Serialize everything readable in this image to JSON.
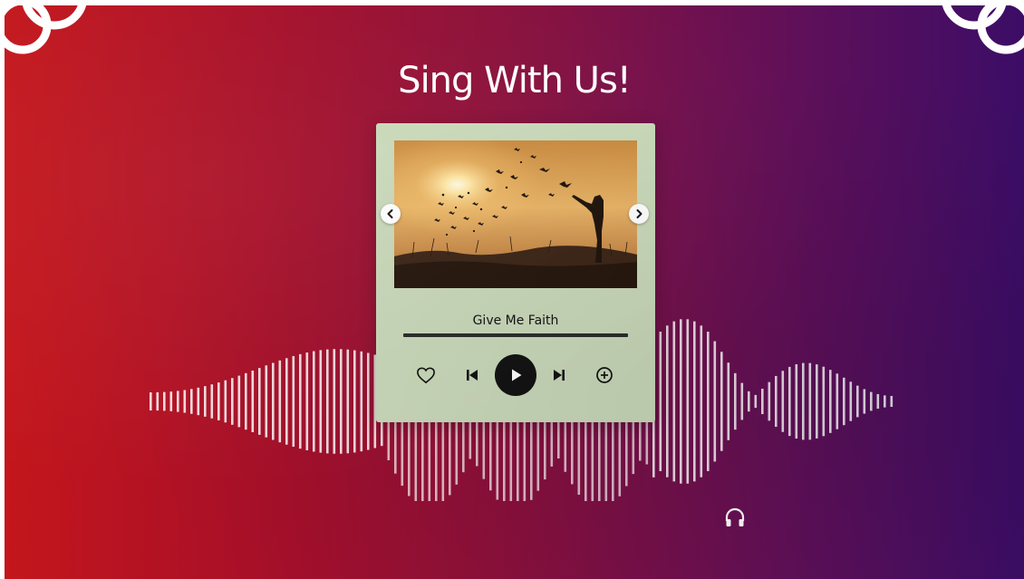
{
  "slide": {
    "title": "Sing With Us!"
  },
  "player": {
    "song_title": "Give Me Faith",
    "progress": 0
  },
  "colors": {
    "card": "#c9d8b9",
    "gradient_left": "#c4161c",
    "gradient_right": "#3c0d67",
    "play_button": "#111111"
  },
  "icons": {
    "prev_image": "chevron-left-icon",
    "next_image": "chevron-right-icon",
    "like": "heart-icon",
    "previous_track": "skip-previous-icon",
    "play": "play-icon",
    "next_track": "skip-next-icon",
    "add": "plus-circle-icon",
    "listen": "headphones-icon"
  }
}
